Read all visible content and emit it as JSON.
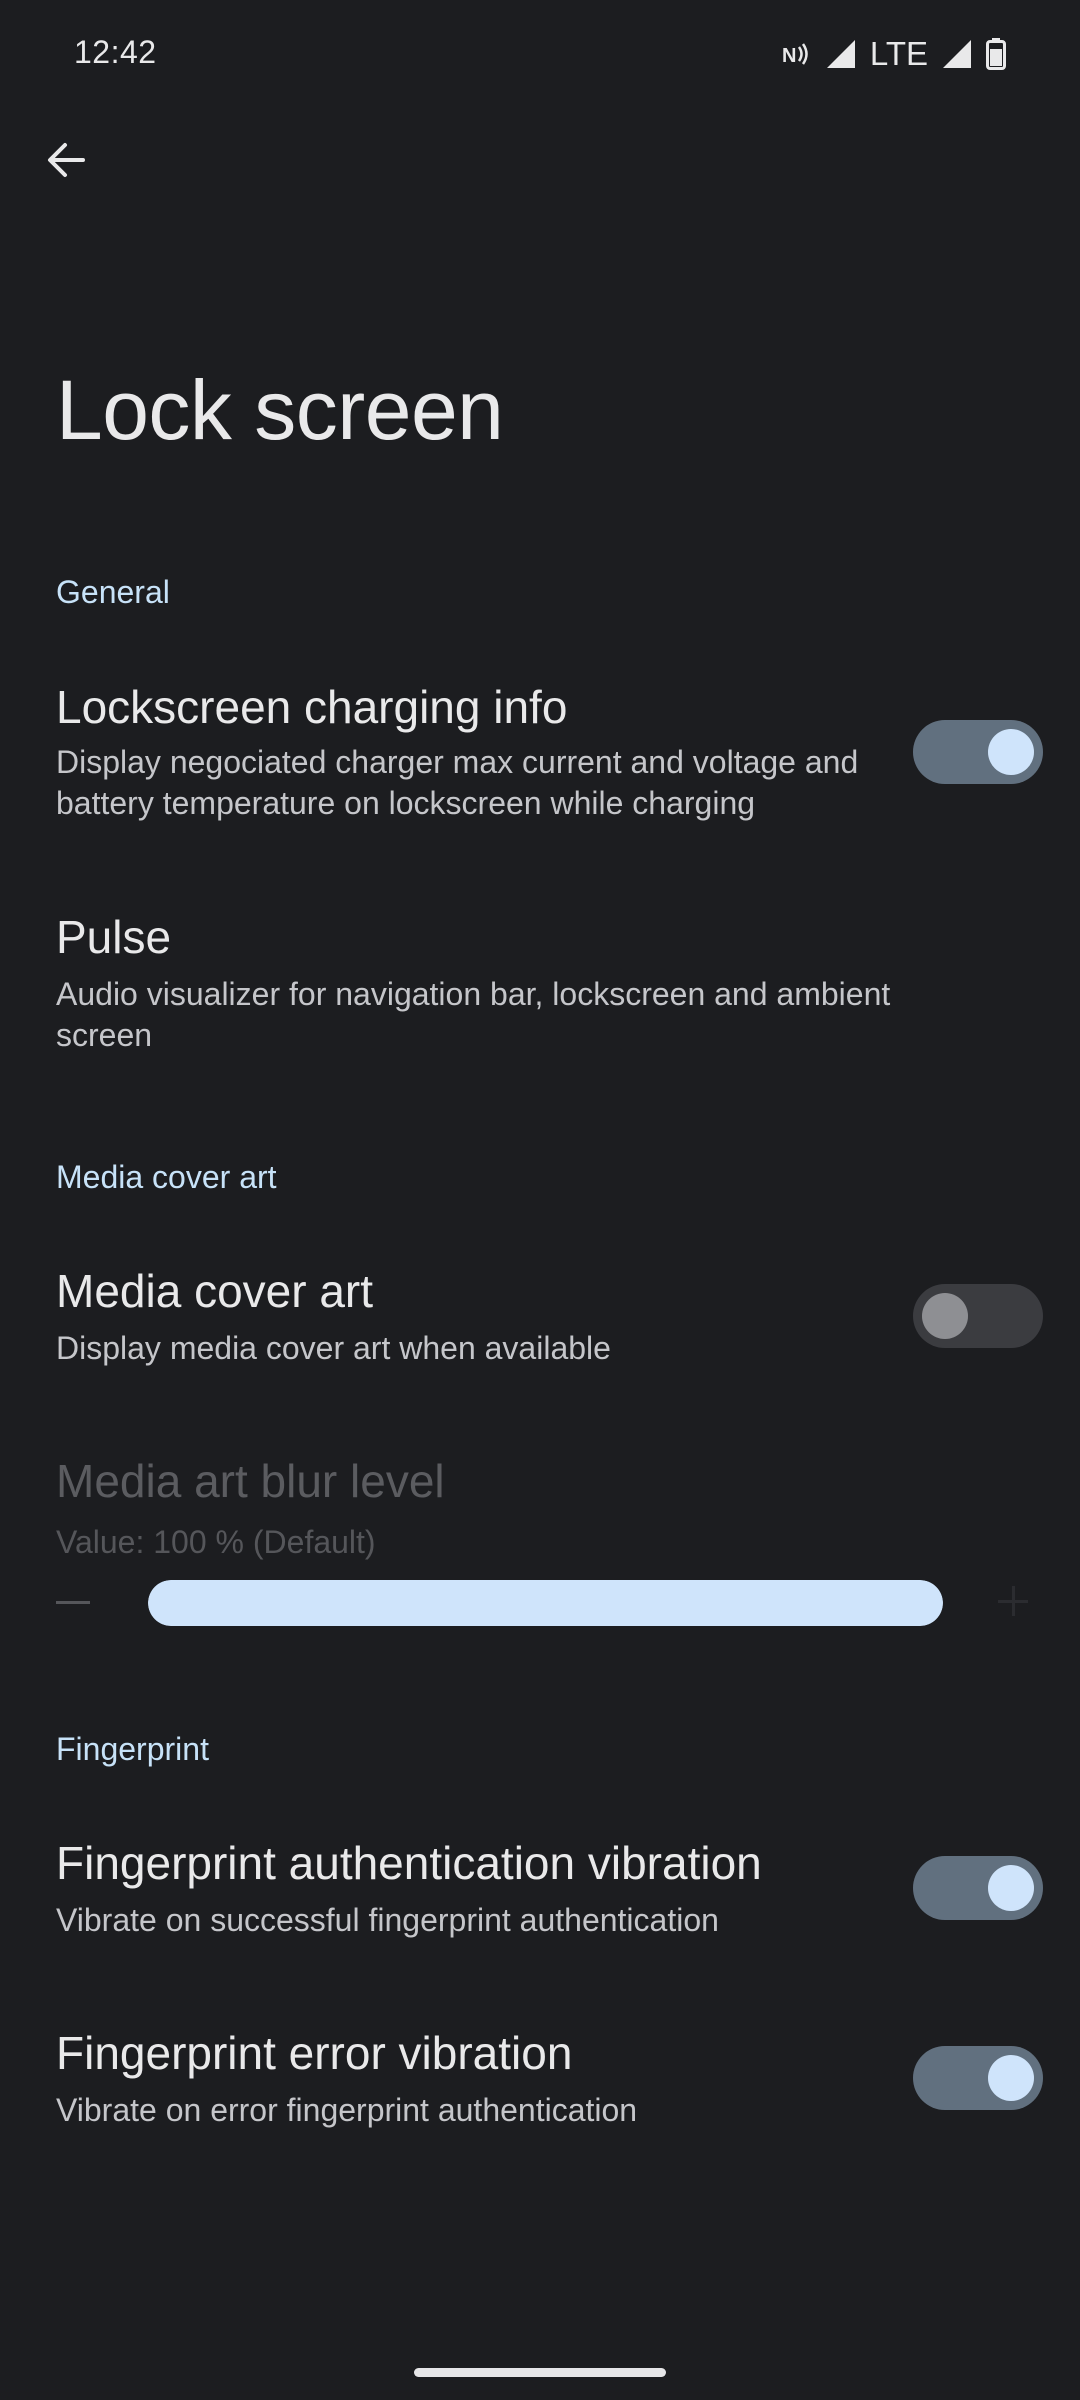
{
  "status_bar": {
    "time": "12:42",
    "network_label": "LTE",
    "icons": [
      "nfc-icon",
      "signal-icon",
      "signal-icon",
      "battery-icon"
    ]
  },
  "header": {
    "back_icon": "arrow-back-icon",
    "title": "Lock screen"
  },
  "sections": {
    "general": {
      "header": "General",
      "lockscreen_charging_info": {
        "title": "Lockscreen charging info",
        "summary": "Display negociated charger max current and voltage and battery temperature on lockscreen while charging",
        "enabled": true
      },
      "pulse": {
        "title": "Pulse",
        "summary": "Audio visualizer for navigation bar, lockscreen and ambient screen"
      }
    },
    "media_cover_art": {
      "header": "Media cover art",
      "media_cover_art": {
        "title": "Media cover art",
        "summary": "Display media cover art when available",
        "enabled": false
      },
      "blur_level": {
        "title": "Media art blur level",
        "summary": "Value: 100 % (Default)",
        "value_percent": 100,
        "disabled": true
      }
    },
    "fingerprint": {
      "header": "Fingerprint",
      "auth_vibration": {
        "title": "Fingerprint authentication vibration",
        "summary": "Vibrate on successful fingerprint authentication",
        "enabled": true
      },
      "error_vibration": {
        "title": "Fingerprint error vibration",
        "summary": "Vibrate on error fingerprint authentication",
        "enabled": true
      }
    }
  },
  "colors": {
    "background": "#1c1d20",
    "accent": "#c7e2f8",
    "switch_on_track": "#61707f",
    "switch_on_thumb": "#cfe4fb"
  }
}
